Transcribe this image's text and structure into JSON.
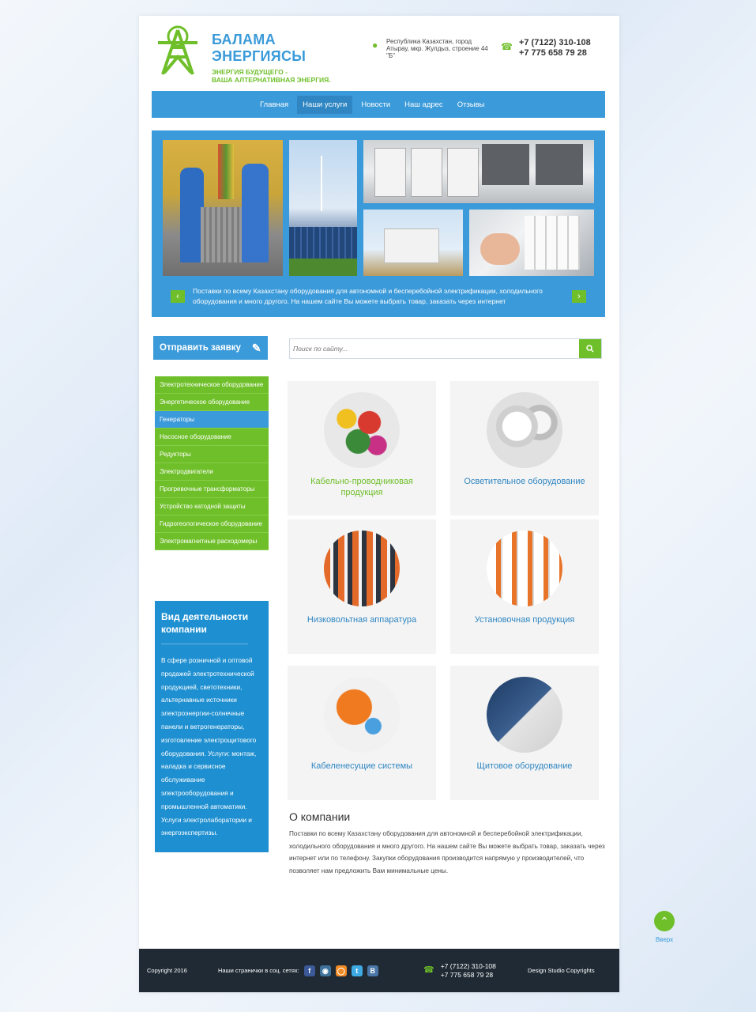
{
  "brand": {
    "title": "БАЛАМА ЭНЕРГИЯСЫ",
    "sub1": "ЭНЕРГИЯ БУДУЩЕГО -",
    "sub2": "ВАША АЛТЕРНАТИВНАЯ ЭНЕРГИЯ."
  },
  "header": {
    "address": "Республика Казахстан, город Атырау, мкр. Жулдыз, строение 44 \"Б\"",
    "phone1": "+7 (7122) 310-108",
    "phone2": "+7 775 658 79 28"
  },
  "nav": {
    "items": [
      "Главная",
      "Наши услуги",
      "Новости",
      "Наш адрес",
      "Отзывы"
    ]
  },
  "slider": {
    "caption": "Поставки по всему Казахстану оборудования для автономной и бесперебойной электрификации, холодильного оборудования и много другого. На нашем сайте Вы можете выбрать товар, заказать через интернет"
  },
  "actions": {
    "apply_label": "Отправить заявку",
    "search_placeholder": "Поиск по сайту..."
  },
  "sidebar": {
    "items": [
      "Электротехническое оборудование",
      "Энергетическое оборудование",
      "Генераторы",
      "Насосное оборудование",
      "Редукторы",
      "Электродвигатели",
      "Прогревочные трансформаторы",
      "Устройство катодной защиты",
      "Гидрогеологическое оборудование",
      "Электромагнитные расходомеры"
    ],
    "about_title": "Вид деятельности компании",
    "about_text": "В сфере розничной и оптовой продажей электротехнической продукцией, светотехники, альтернавные источники электроэнергии-солнечные панели и ветрогенераторы, изготовление электрощитового оборудования. Услуги: монтаж, наладка и сервисное обслуживание электрооборудования и промышленной автоматики. Услуги электролаборатории и энергоэкспертизы."
  },
  "categories": [
    "Кабельно-проводниковая продукция",
    "Осветительное оборудование",
    "Низковольтная аппаратура",
    "Установочная продукция",
    "Кабеленесущие системы",
    "Щитовое оборудование"
  ],
  "about_company": {
    "title": "О компании",
    "text": "Поставки по всему Казахстану оборудования для автономной и бесперебойной электрификации, холодильного оборудования и много другого. На нашем сайте Вы можете выбрать товар, заказать через интернет или по телефону. Закупки оборудования производится напрямую у производителей, что позволяет нам предложить Вам минимальные цены."
  },
  "footer": {
    "copyright": "Copyright 2016",
    "social_label": "Наши странички в соц. сетях:",
    "phone1": "+7 (7122) 310-108",
    "phone2": "+7 775 658 79 28",
    "design": "Design Studio Copyrights"
  },
  "totop": {
    "label": "Вверх"
  },
  "colors": {
    "blue": "#3b9ad9",
    "green": "#6fbf2a",
    "dark": "#1f2a34",
    "about_bg": "#1e8fd0"
  }
}
